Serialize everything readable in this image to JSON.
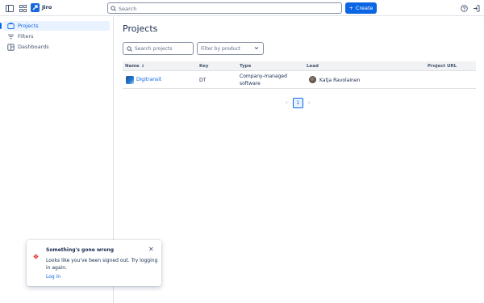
{
  "app": {
    "name": "Jiro"
  },
  "topbar": {
    "search_placeholder": "Search",
    "create_label": "Create"
  },
  "sidebar": {
    "items": [
      {
        "label": "Projects",
        "icon": "projects-icon",
        "active": true
      },
      {
        "label": "Filters",
        "icon": "filter-icon",
        "active": false
      },
      {
        "label": "Dashboards",
        "icon": "dashboard-icon",
        "active": false
      }
    ]
  },
  "main": {
    "title": "Projects",
    "search_projects_placeholder": "Search projects",
    "filter_product_placeholder": "Filter by product",
    "table": {
      "headers": [
        "Name ↓",
        "Key",
        "Type",
        "Lead",
        "Project URL"
      ],
      "rows": [
        {
          "name": "Digitransit",
          "key": "DT",
          "type_line1": "Company-managed",
          "type_line2": "software",
          "lead": "Katja Ravolainen",
          "url": ""
        }
      ]
    },
    "pagination": {
      "current_page": "1"
    }
  },
  "toast": {
    "title": "Something's gone wrong",
    "body": "Looks like you've been signed out. Try logging in again.",
    "link": "Log in"
  },
  "colors": {
    "accent": "#0c66e4",
    "error": "#e2483d"
  }
}
